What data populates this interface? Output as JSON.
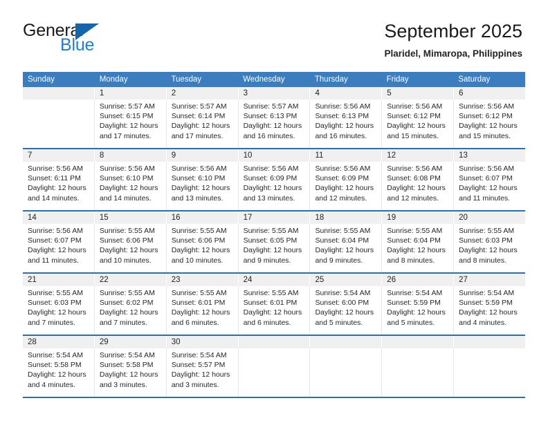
{
  "brand": {
    "name_part1": "General",
    "name_part2": "Blue",
    "logo_icon": "triangle-logo-icon"
  },
  "header": {
    "title": "September 2025",
    "subtitle": "Plaridel, Mimaropa, Philippines"
  },
  "colors": {
    "header_blue": "#3b7dbf",
    "week_divider_blue": "#2c6fae",
    "number_band_gray": "#f0f0f0",
    "brand_blue": "#1f7fd0",
    "logo_blue": "#1565a8",
    "text": "#222222"
  },
  "calendar": {
    "day_headers": [
      "Sunday",
      "Monday",
      "Tuesday",
      "Wednesday",
      "Thursday",
      "Friday",
      "Saturday"
    ],
    "weeks": [
      {
        "days": [
          {
            "num": "",
            "sunrise": "",
            "sunset": "",
            "daylight_line1": "",
            "daylight_line2": "",
            "empty": true
          },
          {
            "num": "1",
            "sunrise": "Sunrise: 5:57 AM",
            "sunset": "Sunset: 6:15 PM",
            "daylight_line1": "Daylight: 12 hours",
            "daylight_line2": "and 17 minutes.",
            "empty": false
          },
          {
            "num": "2",
            "sunrise": "Sunrise: 5:57 AM",
            "sunset": "Sunset: 6:14 PM",
            "daylight_line1": "Daylight: 12 hours",
            "daylight_line2": "and 17 minutes.",
            "empty": false
          },
          {
            "num": "3",
            "sunrise": "Sunrise: 5:57 AM",
            "sunset": "Sunset: 6:13 PM",
            "daylight_line1": "Daylight: 12 hours",
            "daylight_line2": "and 16 minutes.",
            "empty": false
          },
          {
            "num": "4",
            "sunrise": "Sunrise: 5:56 AM",
            "sunset": "Sunset: 6:13 PM",
            "daylight_line1": "Daylight: 12 hours",
            "daylight_line2": "and 16 minutes.",
            "empty": false
          },
          {
            "num": "5",
            "sunrise": "Sunrise: 5:56 AM",
            "sunset": "Sunset: 6:12 PM",
            "daylight_line1": "Daylight: 12 hours",
            "daylight_line2": "and 15 minutes.",
            "empty": false
          },
          {
            "num": "6",
            "sunrise": "Sunrise: 5:56 AM",
            "sunset": "Sunset: 6:12 PM",
            "daylight_line1": "Daylight: 12 hours",
            "daylight_line2": "and 15 minutes.",
            "empty": false
          }
        ]
      },
      {
        "days": [
          {
            "num": "7",
            "sunrise": "Sunrise: 5:56 AM",
            "sunset": "Sunset: 6:11 PM",
            "daylight_line1": "Daylight: 12 hours",
            "daylight_line2": "and 14 minutes.",
            "empty": false
          },
          {
            "num": "8",
            "sunrise": "Sunrise: 5:56 AM",
            "sunset": "Sunset: 6:10 PM",
            "daylight_line1": "Daylight: 12 hours",
            "daylight_line2": "and 14 minutes.",
            "empty": false
          },
          {
            "num": "9",
            "sunrise": "Sunrise: 5:56 AM",
            "sunset": "Sunset: 6:10 PM",
            "daylight_line1": "Daylight: 12 hours",
            "daylight_line2": "and 13 minutes.",
            "empty": false
          },
          {
            "num": "10",
            "sunrise": "Sunrise: 5:56 AM",
            "sunset": "Sunset: 6:09 PM",
            "daylight_line1": "Daylight: 12 hours",
            "daylight_line2": "and 13 minutes.",
            "empty": false
          },
          {
            "num": "11",
            "sunrise": "Sunrise: 5:56 AM",
            "sunset": "Sunset: 6:09 PM",
            "daylight_line1": "Daylight: 12 hours",
            "daylight_line2": "and 12 minutes.",
            "empty": false
          },
          {
            "num": "12",
            "sunrise": "Sunrise: 5:56 AM",
            "sunset": "Sunset: 6:08 PM",
            "daylight_line1": "Daylight: 12 hours",
            "daylight_line2": "and 12 minutes.",
            "empty": false
          },
          {
            "num": "13",
            "sunrise": "Sunrise: 5:56 AM",
            "sunset": "Sunset: 6:07 PM",
            "daylight_line1": "Daylight: 12 hours",
            "daylight_line2": "and 11 minutes.",
            "empty": false
          }
        ]
      },
      {
        "days": [
          {
            "num": "14",
            "sunrise": "Sunrise: 5:56 AM",
            "sunset": "Sunset: 6:07 PM",
            "daylight_line1": "Daylight: 12 hours",
            "daylight_line2": "and 11 minutes.",
            "empty": false
          },
          {
            "num": "15",
            "sunrise": "Sunrise: 5:55 AM",
            "sunset": "Sunset: 6:06 PM",
            "daylight_line1": "Daylight: 12 hours",
            "daylight_line2": "and 10 minutes.",
            "empty": false
          },
          {
            "num": "16",
            "sunrise": "Sunrise: 5:55 AM",
            "sunset": "Sunset: 6:06 PM",
            "daylight_line1": "Daylight: 12 hours",
            "daylight_line2": "and 10 minutes.",
            "empty": false
          },
          {
            "num": "17",
            "sunrise": "Sunrise: 5:55 AM",
            "sunset": "Sunset: 6:05 PM",
            "daylight_line1": "Daylight: 12 hours",
            "daylight_line2": "and 9 minutes.",
            "empty": false
          },
          {
            "num": "18",
            "sunrise": "Sunrise: 5:55 AM",
            "sunset": "Sunset: 6:04 PM",
            "daylight_line1": "Daylight: 12 hours",
            "daylight_line2": "and 9 minutes.",
            "empty": false
          },
          {
            "num": "19",
            "sunrise": "Sunrise: 5:55 AM",
            "sunset": "Sunset: 6:04 PM",
            "daylight_line1": "Daylight: 12 hours",
            "daylight_line2": "and 8 minutes.",
            "empty": false
          },
          {
            "num": "20",
            "sunrise": "Sunrise: 5:55 AM",
            "sunset": "Sunset: 6:03 PM",
            "daylight_line1": "Daylight: 12 hours",
            "daylight_line2": "and 8 minutes.",
            "empty": false
          }
        ]
      },
      {
        "days": [
          {
            "num": "21",
            "sunrise": "Sunrise: 5:55 AM",
            "sunset": "Sunset: 6:03 PM",
            "daylight_line1": "Daylight: 12 hours",
            "daylight_line2": "and 7 minutes.",
            "empty": false
          },
          {
            "num": "22",
            "sunrise": "Sunrise: 5:55 AM",
            "sunset": "Sunset: 6:02 PM",
            "daylight_line1": "Daylight: 12 hours",
            "daylight_line2": "and 7 minutes.",
            "empty": false
          },
          {
            "num": "23",
            "sunrise": "Sunrise: 5:55 AM",
            "sunset": "Sunset: 6:01 PM",
            "daylight_line1": "Daylight: 12 hours",
            "daylight_line2": "and 6 minutes.",
            "empty": false
          },
          {
            "num": "24",
            "sunrise": "Sunrise: 5:55 AM",
            "sunset": "Sunset: 6:01 PM",
            "daylight_line1": "Daylight: 12 hours",
            "daylight_line2": "and 6 minutes.",
            "empty": false
          },
          {
            "num": "25",
            "sunrise": "Sunrise: 5:54 AM",
            "sunset": "Sunset: 6:00 PM",
            "daylight_line1": "Daylight: 12 hours",
            "daylight_line2": "and 5 minutes.",
            "empty": false
          },
          {
            "num": "26",
            "sunrise": "Sunrise: 5:54 AM",
            "sunset": "Sunset: 5:59 PM",
            "daylight_line1": "Daylight: 12 hours",
            "daylight_line2": "and 5 minutes.",
            "empty": false
          },
          {
            "num": "27",
            "sunrise": "Sunrise: 5:54 AM",
            "sunset": "Sunset: 5:59 PM",
            "daylight_line1": "Daylight: 12 hours",
            "daylight_line2": "and 4 minutes.",
            "empty": false
          }
        ]
      },
      {
        "days": [
          {
            "num": "28",
            "sunrise": "Sunrise: 5:54 AM",
            "sunset": "Sunset: 5:58 PM",
            "daylight_line1": "Daylight: 12 hours",
            "daylight_line2": "and 4 minutes.",
            "empty": false
          },
          {
            "num": "29",
            "sunrise": "Sunrise: 5:54 AM",
            "sunset": "Sunset: 5:58 PM",
            "daylight_line1": "Daylight: 12 hours",
            "daylight_line2": "and 3 minutes.",
            "empty": false
          },
          {
            "num": "30",
            "sunrise": "Sunrise: 5:54 AM",
            "sunset": "Sunset: 5:57 PM",
            "daylight_line1": "Daylight: 12 hours",
            "daylight_line2": "and 3 minutes.",
            "empty": false
          },
          {
            "num": "",
            "sunrise": "",
            "sunset": "",
            "daylight_line1": "",
            "daylight_line2": "",
            "empty": true
          },
          {
            "num": "",
            "sunrise": "",
            "sunset": "",
            "daylight_line1": "",
            "daylight_line2": "",
            "empty": true
          },
          {
            "num": "",
            "sunrise": "",
            "sunset": "",
            "daylight_line1": "",
            "daylight_line2": "",
            "empty": true
          },
          {
            "num": "",
            "sunrise": "",
            "sunset": "",
            "daylight_line1": "",
            "daylight_line2": "",
            "empty": true
          }
        ]
      }
    ]
  }
}
